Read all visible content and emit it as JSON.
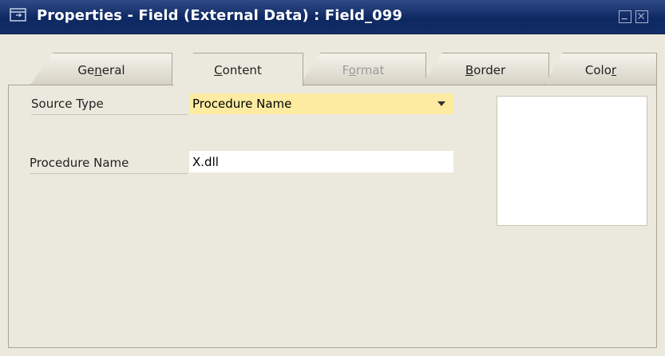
{
  "window": {
    "title": "Properties - Field (External Data) : Field_099",
    "title_icon": "properties-icon",
    "minimize_icon": "minimize-icon",
    "close_icon": "close-icon"
  },
  "tabs": [
    {
      "label_pre": "Ge",
      "label_mnemonic": "n",
      "label_post": "eral",
      "state": "normal"
    },
    {
      "label_pre": "",
      "label_mnemonic": "C",
      "label_post": "ontent",
      "state": "active"
    },
    {
      "label_pre": "F",
      "label_mnemonic": "o",
      "label_post": "rmat",
      "state": "disabled"
    },
    {
      "label_pre": "",
      "label_mnemonic": "B",
      "label_post": "order",
      "state": "normal"
    },
    {
      "label_pre": "Colo",
      "label_mnemonic": "r",
      "label_post": "",
      "state": "normal"
    }
  ],
  "content": {
    "source_type_label": "Source Type",
    "source_type_value": "Procedure Name",
    "procedure_name_label": "Procedure Name",
    "procedure_name_value": "X.dll"
  },
  "colors": {
    "titlebar": "#0e2862",
    "background": "#ebe9dd",
    "select_highlight": "#fdeba1"
  }
}
